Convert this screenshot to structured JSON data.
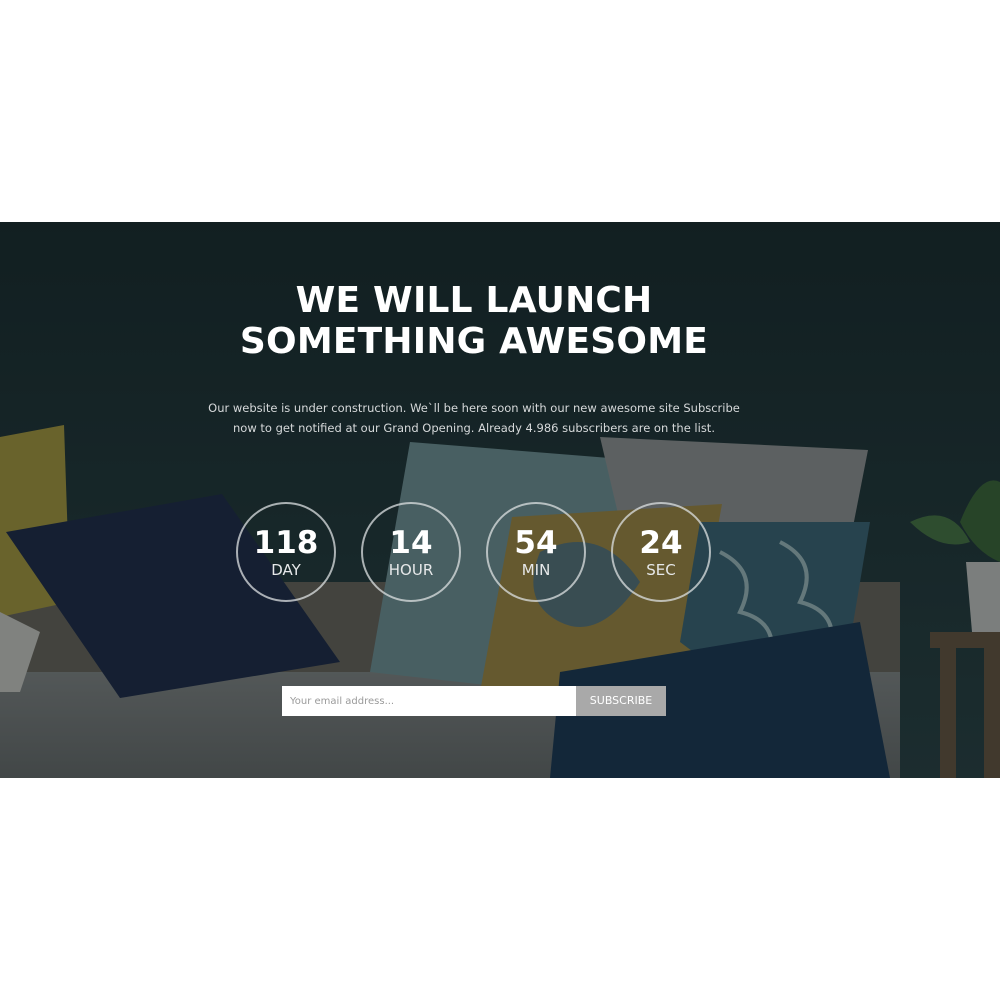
{
  "hero": {
    "headline_line1": "WE WILL LAUNCH",
    "headline_line2": "SOMETHING AWESOME",
    "description": "Our website is under construction. We`ll be here soon with our new awesome site Subscribe now to get notified at our Grand Opening. Already 4.986 subscribers are on the list.",
    "background_description": "sofa-with-pillows-photo"
  },
  "countdown": [
    {
      "value": "118",
      "unit": "DAY"
    },
    {
      "value": "14",
      "unit": "HOUR"
    },
    {
      "value": "54",
      "unit": "MIN"
    },
    {
      "value": "24",
      "unit": "SEC"
    }
  ],
  "subscribe": {
    "email_placeholder": "Your email address...",
    "email_value": "",
    "button_label": "SUBSCRIBE"
  },
  "colors": {
    "page_background": "#ffffff",
    "hero_wall": "#1c3335",
    "button_background": "#a9a9a9",
    "text_primary": "#ffffff"
  }
}
